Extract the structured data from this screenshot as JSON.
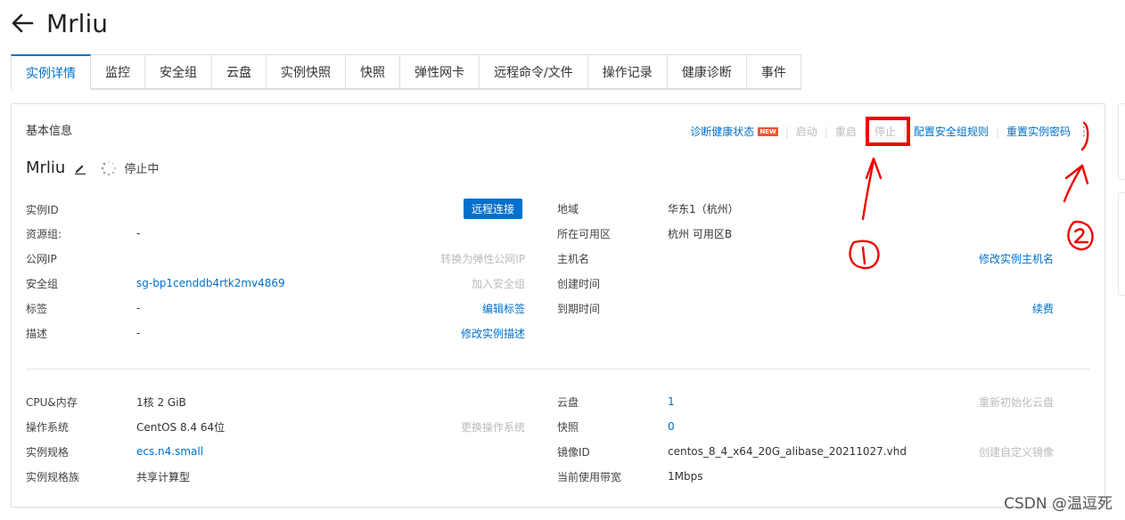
{
  "header": {
    "title": "Mrliu"
  },
  "tabs": [
    {
      "label": "实例详情"
    },
    {
      "label": "监控"
    },
    {
      "label": "安全组"
    },
    {
      "label": "云盘"
    },
    {
      "label": "实例快照"
    },
    {
      "label": "快照"
    },
    {
      "label": "弹性网卡"
    },
    {
      "label": "远程命令/文件"
    },
    {
      "label": "操作记录"
    },
    {
      "label": "健康诊断"
    },
    {
      "label": "事件"
    }
  ],
  "basic": {
    "section_title": "基本信息",
    "actions": {
      "diagnose": "诊断健康状态",
      "new_badge": "NEW",
      "start": "启动",
      "restart": "重启",
      "stop": "停止",
      "config_sg": "配置安全组规则",
      "reset_pwd": "重置实例密码"
    },
    "instance_name": "Mrliu",
    "status": "停止中",
    "remote_connect": "远程连接",
    "left": [
      {
        "label": "实例ID",
        "value": "",
        "action": ""
      },
      {
        "label": "资源组:",
        "value": "-",
        "action": ""
      },
      {
        "label": "公网IP",
        "value": "",
        "action": "转换为弹性公网IP"
      },
      {
        "label": "安全组",
        "value": "sg-bp1cenddb4rtk2mv4869",
        "action": "加入安全组"
      },
      {
        "label": "标签",
        "value": "-",
        "action": "编辑标签"
      },
      {
        "label": "描述",
        "value": "-",
        "action": "修改实例描述"
      }
    ],
    "right": [
      {
        "label": "地域",
        "value": "华东1（杭州）",
        "action": ""
      },
      {
        "label": "所在可用区",
        "value": "杭州 可用区B",
        "action": ""
      },
      {
        "label": "主机名",
        "value": "",
        "action": "修改实例主机名"
      },
      {
        "label": "创建时间",
        "value": "",
        "action": ""
      },
      {
        "label": "到期时间",
        "value": "",
        "action": "续费"
      }
    ]
  },
  "config": {
    "left": [
      {
        "label": "CPU&内存",
        "value": "1核 2 GiB",
        "action": ""
      },
      {
        "label": "操作系统",
        "value": "CentOS 8.4 64位",
        "action": "更换操作系统"
      },
      {
        "label": "实例规格",
        "value": "ecs.n4.small",
        "action": ""
      },
      {
        "label": "实例规格族",
        "value": "共享计算型",
        "action": ""
      }
    ],
    "right": [
      {
        "label": "云盘",
        "value": "1",
        "action": "重新初始化云盘"
      },
      {
        "label": "快照",
        "value": "0",
        "action": ""
      },
      {
        "label": "镜像ID",
        "value": "centos_8_4_x64_20G_alibase_20211027.vhd",
        "action": "创建自定义镜像"
      },
      {
        "label": "当前使用带宽",
        "value": "1Mbps",
        "action": ""
      }
    ]
  },
  "watermark": "CSDN @温逗死",
  "colors": {
    "accent": "#0070cc",
    "annotation": "#e00000"
  }
}
